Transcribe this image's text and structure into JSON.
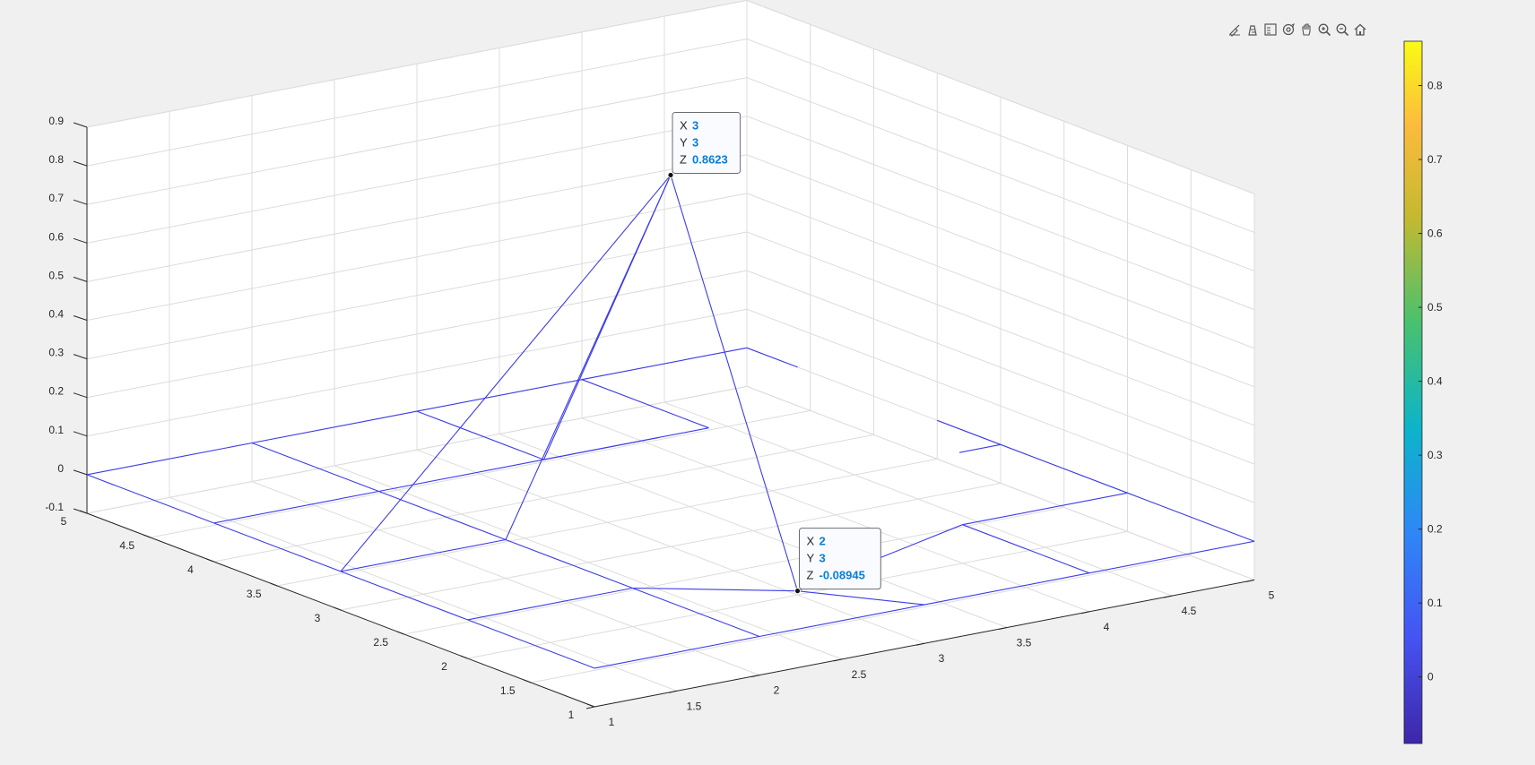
{
  "toolbar": {
    "icons": [
      "brush-icon",
      "datatip-icon",
      "legend-icon",
      "rotate-3d-icon",
      "pan-icon",
      "zoom-in-icon",
      "zoom-out-icon",
      "home-icon"
    ]
  },
  "colors": {
    "figure_background": "#f0f0f0",
    "axes_background": "#ffffff",
    "grid": "#dcdcdc",
    "mesh_line": "#3c3ce6",
    "axis_line": "#262626",
    "datatip_value": "#0a7ed6"
  },
  "chart_data": {
    "type": "mesh3d",
    "x": [
      1,
      2,
      3,
      4,
      5
    ],
    "y": [
      1,
      2,
      3,
      4,
      5
    ],
    "x_ticks": [
      "1",
      "1.5",
      "2",
      "2.5",
      "3",
      "3.5",
      "4",
      "4.5",
      "5"
    ],
    "y_ticks": [
      "1",
      "1.5",
      "2",
      "2.5",
      "3",
      "3.5",
      "4",
      "4.5",
      "5"
    ],
    "z_ticks": [
      "-0.1",
      "0",
      "0.1",
      "0.2",
      "0.3",
      "0.4",
      "0.5",
      "0.6",
      "0.7",
      "0.8",
      "0.9"
    ],
    "xlim": [
      1,
      5
    ],
    "ylim": [
      1,
      5
    ],
    "zlim": [
      -0.1,
      0.9
    ],
    "grid": true,
    "surface_pieces": [
      [
        [
          1,
          5,
          0
        ],
        [
          2,
          5,
          0
        ],
        [
          3,
          5,
          0
        ],
        [
          3.5,
          5,
          0
        ]
      ],
      [
        [
          1,
          5,
          0
        ],
        [
          1,
          4,
          0
        ],
        [
          1,
          3,
          0
        ],
        [
          1,
          2,
          0
        ],
        [
          1,
          1,
          0
        ]
      ],
      [
        [
          1,
          1,
          0
        ],
        [
          2,
          1,
          0
        ],
        [
          3,
          1,
          0
        ],
        [
          4,
          1,
          0
        ],
        [
          5,
          1,
          0
        ]
      ],
      [
        [
          5,
          1,
          0
        ],
        [
          5,
          2,
          0
        ],
        [
          5,
          3,
          0
        ],
        [
          5,
          4,
          0
        ],
        [
          5,
          5,
          0
        ]
      ],
      [
        [
          1,
          4,
          0
        ],
        [
          2,
          4,
          0
        ]
      ],
      [
        [
          2,
          5,
          0
        ],
        [
          2,
          4,
          0
        ],
        [
          2,
          3,
          -0.08945
        ],
        [
          2,
          2,
          0
        ],
        [
          2,
          1,
          0
        ]
      ],
      [
        [
          1,
          3,
          0
        ],
        [
          2,
          3,
          -0.08945
        ]
      ],
      [
        [
          1,
          2,
          0
        ],
        [
          2,
          2,
          0
        ],
        [
          3,
          2,
          0
        ],
        [
          4,
          2,
          0
        ],
        [
          5,
          2,
          0
        ]
      ],
      [
        [
          2,
          3,
          -0.08945
        ],
        [
          3,
          3,
          0.8623
        ],
        [
          4,
          3,
          0
        ],
        [
          5,
          3,
          0
        ]
      ],
      [
        [
          3,
          2,
          0
        ],
        [
          3,
          3,
          0.8623
        ],
        [
          3,
          1,
          0
        ]
      ],
      [
        [
          3,
          1,
          0
        ],
        [
          3,
          2,
          0
        ]
      ],
      [
        [
          4,
          1,
          0
        ],
        [
          4,
          2,
          0
        ],
        [
          4,
          3,
          0
        ],
        [
          4,
          4,
          0
        ]
      ],
      [
        [
          4,
          3,
          0
        ],
        [
          4,
          3.7,
          0
        ]
      ],
      [
        [
          4,
          4,
          0
        ],
        [
          5,
          4,
          0
        ]
      ],
      [
        [
          5,
          5,
          0
        ],
        [
          4.6,
          5,
          0
        ]
      ],
      [
        [
          3,
          5,
          0
        ],
        [
          3,
          4.75,
          0
        ]
      ]
    ],
    "colorbar": {
      "ticks": [
        "0",
        "0.1",
        "0.2",
        "0.3",
        "0.4",
        "0.5",
        "0.6",
        "0.7",
        "0.8"
      ],
      "min": -0.09,
      "max": 0.86
    },
    "datatips": [
      {
        "x": "3",
        "y": "3",
        "z": "0.8623",
        "at": [
          3,
          3,
          0.8623
        ]
      },
      {
        "x": "2",
        "y": "3",
        "z": "-0.08945",
        "at": [
          2,
          3,
          -0.08945
        ]
      }
    ]
  }
}
